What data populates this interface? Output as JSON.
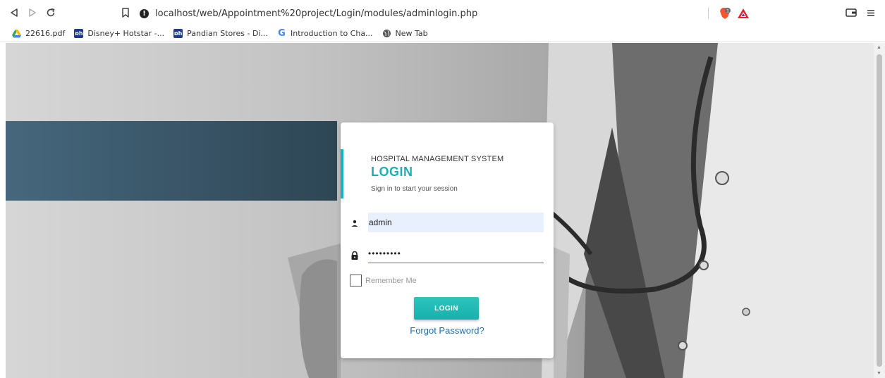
{
  "browser": {
    "url": "localhost/web/Appointment%20project/Login/modules/adminlogin.php",
    "bookmarks": [
      {
        "label": "22616.pdf",
        "icon": "google-drive-icon"
      },
      {
        "label": "Disney+ Hotstar -...",
        "icon": "hotstar-icon"
      },
      {
        "label": "Pandian Stores - Di...",
        "icon": "hotstar-icon"
      },
      {
        "label": "Introduction to Cha...",
        "icon": "google-icon"
      },
      {
        "label": "New Tab",
        "icon": "globe-icon"
      }
    ],
    "colors": {
      "brave": "#fb542b",
      "rewards": "#e2222e"
    }
  },
  "login": {
    "system_name": "HOSPITAL MANAGEMENT SYSTEM",
    "title": "LOGIN",
    "subtitle": "Sign in to start your session",
    "username_value": "admin",
    "password_value": "•••••••••",
    "remember_label": "Remember Me",
    "button_label": "LOGIN",
    "forgot_label": "Forgot Password?"
  },
  "theme": {
    "accent": "#1ab0b3",
    "link": "#1f6fb3",
    "band": "#3b5667"
  }
}
